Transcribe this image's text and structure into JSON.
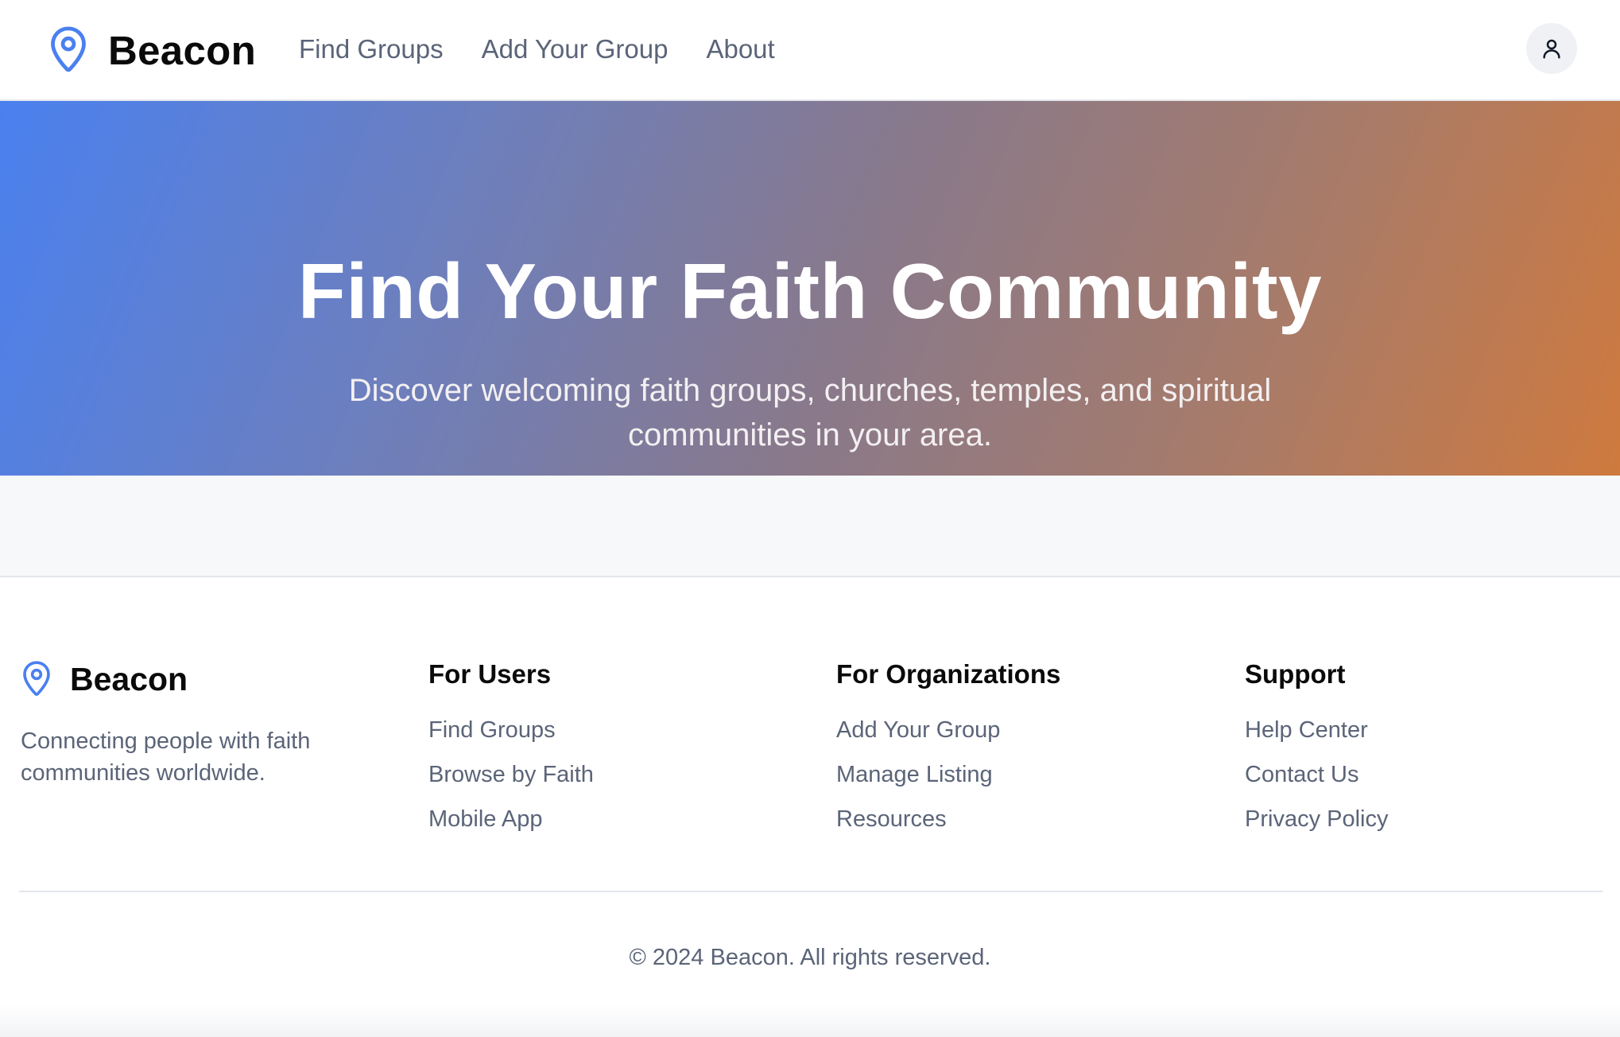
{
  "brand": {
    "name": "Beacon",
    "accent_color": "#4a80ef",
    "icon": "map-pin-icon"
  },
  "nav": {
    "items": [
      {
        "label": "Find Groups"
      },
      {
        "label": "Add Your Group"
      },
      {
        "label": "About"
      }
    ]
  },
  "user_menu": {
    "icon": "user-icon"
  },
  "hero": {
    "title": "Find Your Faith Community",
    "subtitle": "Discover welcoming faith groups, churches, temples, and spiritual communities in your area.",
    "gradient_start": "#4a80ef",
    "gradient_end": "#cf7a3e"
  },
  "footer": {
    "brand_name": "Beacon",
    "tagline": "Connecting people with faith communities worldwide.",
    "columns": [
      {
        "heading": "For Users",
        "links": [
          "Find Groups",
          "Browse by Faith",
          "Mobile App"
        ]
      },
      {
        "heading": "For Organizations",
        "links": [
          "Add Your Group",
          "Manage Listing",
          "Resources"
        ]
      },
      {
        "heading": "Support",
        "links": [
          "Help Center",
          "Contact Us",
          "Privacy Policy"
        ]
      }
    ],
    "copyright": "© 2024 Beacon. All rights reserved."
  }
}
